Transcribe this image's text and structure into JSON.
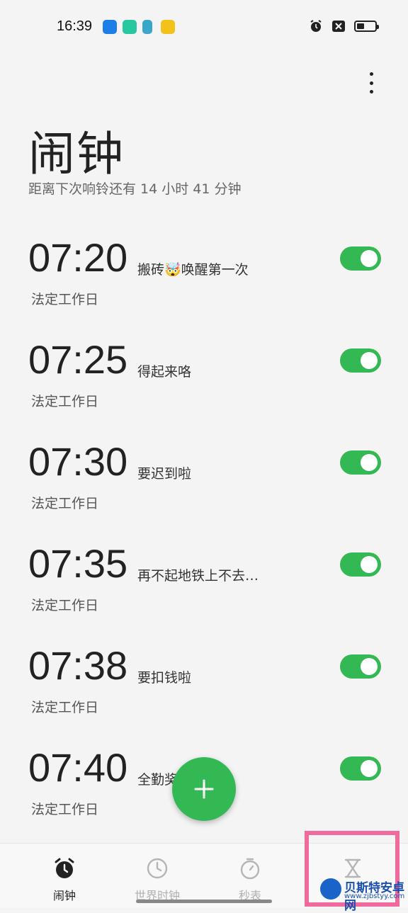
{
  "status_bar": {
    "time": "16:39",
    "icons": [
      "qq-icon",
      "app-icon",
      "map-icon",
      "diamond-icon"
    ],
    "right_icons": [
      "alarm-icon",
      "sim-off-icon",
      "battery-icon"
    ],
    "battery_level": 0.4
  },
  "page": {
    "title": "闹钟",
    "subtitle": "距离下次响铃还有  14 小时 41 分钟"
  },
  "alarms": [
    {
      "time": "07:20",
      "label": "搬砖🤯唤醒第一次",
      "repeat": "法定工作日",
      "enabled": true
    },
    {
      "time": "07:25",
      "label": "得起来咯",
      "repeat": "法定工作日",
      "enabled": true
    },
    {
      "time": "07:30",
      "label": "要迟到啦",
      "repeat": "法定工作日",
      "enabled": true
    },
    {
      "time": "07:35",
      "label": "再不起地铁上不去…",
      "repeat": "法定工作日",
      "enabled": true
    },
    {
      "time": "07:38",
      "label": "要扣钱啦",
      "repeat": "法定工作日",
      "enabled": true
    },
    {
      "time": "07:40",
      "label": "全勤奖",
      "repeat": "法定工作日",
      "enabled": true
    }
  ],
  "bottom_nav": [
    {
      "label": "闹钟",
      "icon": "alarm-clock-icon",
      "active": true
    },
    {
      "label": "世界时钟",
      "icon": "clock-icon",
      "active": false
    },
    {
      "label": "秒表",
      "icon": "stopwatch-icon",
      "active": false
    },
    {
      "label": "",
      "icon": "hourglass-icon",
      "active": false
    }
  ],
  "watermark": {
    "title": "贝斯特安卓网",
    "url": "www.zjbstyy.com"
  },
  "colors": {
    "accent": "#34b853",
    "highlight": "#f06a9e",
    "background": "#f4f4f4"
  }
}
